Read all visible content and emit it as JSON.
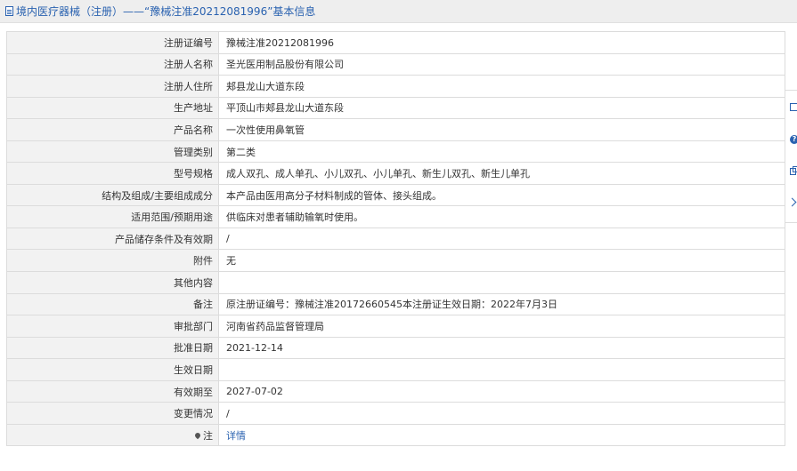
{
  "header": {
    "title": "境内医疗器械（注册）——“豫械注准20212081996”基本信息"
  },
  "rows": [
    {
      "label": "注册证编号",
      "value": "豫械注准20212081996"
    },
    {
      "label": "注册人名称",
      "value": "圣光医用制品股份有限公司"
    },
    {
      "label": "注册人住所",
      "value": "郏县龙山大道东段"
    },
    {
      "label": "生产地址",
      "value": "平顶山市郏县龙山大道东段"
    },
    {
      "label": "产品名称",
      "value": "一次性使用鼻氧管"
    },
    {
      "label": "管理类别",
      "value": "第二类"
    },
    {
      "label": "型号规格",
      "value": "成人双孔、成人单孔、小儿双孔、小儿单孔、新生儿双孔、新生儿单孔"
    },
    {
      "label": "结构及组成/主要组成成分",
      "value": "本产品由医用高分子材料制成的管体、接头组成。"
    },
    {
      "label": "适用范围/预期用途",
      "value": "供临床对患者辅助输氧时使用。"
    },
    {
      "label": "产品储存条件及有效期",
      "value": "/"
    },
    {
      "label": "附件",
      "value": "无"
    },
    {
      "label": "其他内容",
      "value": ""
    },
    {
      "label": "备注",
      "value": "原注册证编号：豫械注准20172660545本注册证生效日期：2022年7月3日"
    },
    {
      "label": "审批部门",
      "value": "河南省药品监督管理局"
    },
    {
      "label": "批准日期",
      "value": "2021-12-14"
    },
    {
      "label": "生效日期",
      "value": ""
    },
    {
      "label": "有效期至",
      "value": "2027-07-02"
    },
    {
      "label": "变更情况",
      "value": "/"
    }
  ],
  "note_row": {
    "label": "注",
    "link_text": "详情",
    "icon": "pin-icon"
  },
  "side_panel": {
    "icons": [
      "edit-icon",
      "help-icon",
      "copy-icon",
      "next-icon"
    ],
    "help_glyph": "?"
  },
  "colors": {
    "link": "#2a62b0",
    "label_bg": "#f2f2f2",
    "header_bg": "#eeeeee"
  }
}
